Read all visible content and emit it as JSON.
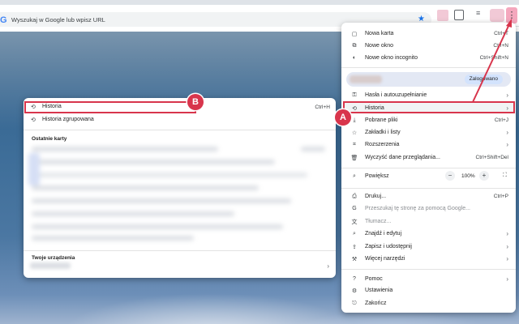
{
  "browser": {
    "omnibox_placeholder": "Wyszukaj w Google lub wpisz URL",
    "google_icon": "G"
  },
  "menu": {
    "items_top": [
      {
        "label": "Nowa karta",
        "shortcut": "Ctrl+T",
        "icon": "new-tab-icon"
      },
      {
        "label": "Nowe okno",
        "shortcut": "Ctrl+N",
        "icon": "new-window-icon"
      },
      {
        "label": "Nowe okno incognito",
        "shortcut": "Ctrl+Shift+N",
        "icon": "incognito-icon"
      }
    ],
    "profile_badge": "Zalogowano",
    "items_mid": [
      {
        "label": "Hasła i autouzupełnianie",
        "icon": "key-icon",
        "arrow": "›"
      },
      {
        "label": "Historia",
        "icon": "history-icon",
        "arrow": "›"
      },
      {
        "label": "Pobrane pliki",
        "shortcut": "Ctrl+J",
        "icon": "download-icon"
      },
      {
        "label": "Zakładki i listy",
        "icon": "star-icon",
        "arrow": "›"
      },
      {
        "label": "Rozszerzenia",
        "icon": "extensions-icon",
        "arrow": "›"
      },
      {
        "label": "Wyczyść dane przeglądania...",
        "shortcut": "Ctrl+Shift+Del",
        "icon": "trash-icon"
      }
    ],
    "zoom": {
      "label": "Powiększ",
      "value": "100%",
      "minus": "−",
      "plus": "+"
    },
    "items_tools": [
      {
        "label": "Drukuj...",
        "shortcut": "Ctrl+P",
        "icon": "print-icon"
      },
      {
        "label": "Przeszukaj tę stronę za pomocą Google...",
        "icon": "google-lens-icon",
        "dim": true
      },
      {
        "label": "Tłumacz...",
        "icon": "translate-icon",
        "dim": true
      },
      {
        "label": "Znajdź i edytuj",
        "icon": "find-icon",
        "arrow": "›"
      },
      {
        "label": "Zapisz i udostępnij",
        "icon": "save-share-icon",
        "arrow": "›"
      },
      {
        "label": "Więcej narzędzi",
        "icon": "more-tools-icon",
        "arrow": "›"
      }
    ],
    "items_bottom": [
      {
        "label": "Pomoc",
        "icon": "help-icon",
        "arrow": "›"
      },
      {
        "label": "Ustawienia",
        "icon": "settings-icon"
      },
      {
        "label": "Zakończ",
        "icon": "exit-icon"
      }
    ]
  },
  "history_submenu": {
    "items": [
      {
        "label": "Historia",
        "shortcut": "Ctrl+H",
        "icon": "history-icon"
      },
      {
        "label": "Historia zgrupowana",
        "icon": "history-icon"
      }
    ],
    "recent_tabs_title": "Ostatnie karty",
    "devices_title": "Twoje urządzenia",
    "devices_arrow": "›"
  },
  "annotations": {
    "badge_a": "A",
    "badge_b": "B",
    "color": "#d8354c"
  }
}
